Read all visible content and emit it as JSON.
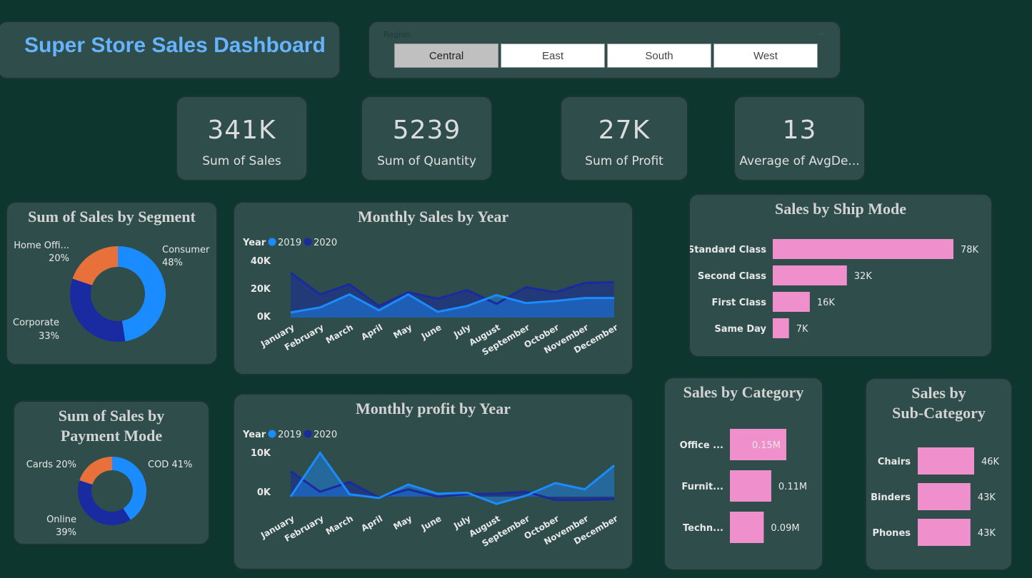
{
  "dashboard": {
    "title": "Super Store Sales Dashboard"
  },
  "slicer": {
    "title": "Region",
    "options": [
      "Central",
      "East",
      "South",
      "West"
    ],
    "selected": "Central"
  },
  "kpis": [
    {
      "value": "341K",
      "label": "Sum of Sales"
    },
    {
      "value": "5239",
      "label": "Sum of Quantity"
    },
    {
      "value": "27K",
      "label": "Sum of Profit"
    },
    {
      "value": "13",
      "label": "Average of AvgDe..."
    }
  ],
  "colors": {
    "background": "#0d362f",
    "card": "#2f4e4b",
    "title_blue": "#66b3ff",
    "series_2019": "#1a8cff",
    "series_2020": "#1a2aa0",
    "accent_orange": "#e8703a",
    "bar_pink": "#ef8fcb",
    "chevron": "chevron-down-icon"
  },
  "chart_data": [
    {
      "id": "segment",
      "type": "pie",
      "title": "Sum of Sales by Segment",
      "categories": [
        "Consumer",
        "Corporate",
        "Home Offi..."
      ],
      "values": [
        48,
        33,
        20
      ],
      "labels": [
        "48%",
        "33%",
        "20%"
      ],
      "colors": [
        "#1a8cff",
        "#1a2aa0",
        "#e8703a"
      ]
    },
    {
      "id": "payment",
      "type": "pie",
      "title_lines": [
        "Sum of Sales by",
        "Payment Mode"
      ],
      "categories": [
        "COD",
        "Online",
        "Cards"
      ],
      "values": [
        41,
        39,
        20
      ],
      "labels": [
        "COD 41%",
        "39%",
        "Cards 20%"
      ],
      "colors": [
        "#1a8cff",
        "#1a2aa0",
        "#e8703a"
      ]
    },
    {
      "id": "monthly_sales",
      "type": "area",
      "title": "Monthly Sales by Year",
      "legend_title": "Year",
      "categories": [
        "January",
        "February",
        "March",
        "April",
        "May",
        "June",
        "July",
        "August",
        "September",
        "October",
        "November",
        "December"
      ],
      "series": [
        {
          "name": "2019",
          "values": [
            3500,
            7000,
            16000,
            5000,
            16000,
            4000,
            8000,
            15500,
            10000,
            11500,
            13500,
            13500
          ]
        },
        {
          "name": "2020",
          "values": [
            31000,
            16000,
            23000,
            8000,
            17500,
            13000,
            19000,
            9500,
            21000,
            17500,
            24000,
            24500
          ]
        }
      ],
      "yticks": [
        "40K",
        "20K",
        "0K"
      ],
      "ylim": [
        0,
        40000
      ]
    },
    {
      "id": "monthly_profit",
      "type": "area",
      "title": "Monthly profit by Year",
      "legend_title": "Year",
      "categories": [
        "January",
        "February",
        "March",
        "April",
        "May",
        "June",
        "July",
        "August",
        "September",
        "October",
        "November",
        "December"
      ],
      "series": [
        {
          "name": "2019",
          "values": [
            0,
            9000,
            500,
            -300,
            2500,
            600,
            800,
            -1500,
            200,
            2800,
            1500,
            6400
          ]
        },
        {
          "name": "2020",
          "values": [
            5200,
            1000,
            3000,
            -200,
            1500,
            0,
            500,
            600,
            1000,
            -700,
            -700,
            -500
          ]
        }
      ],
      "yticks": [
        "10K",
        "0K"
      ],
      "ylim": [
        -2500,
        11000
      ]
    },
    {
      "id": "ship_mode",
      "type": "bar",
      "title": "Sales by Ship Mode",
      "categories": [
        "Standard Class",
        "Second Class",
        "First Class",
        "Same Day"
      ],
      "values": [
        78,
        32,
        16,
        7
      ],
      "labels": [
        "78K",
        "32K",
        "16K",
        "7K"
      ]
    },
    {
      "id": "category",
      "type": "bar",
      "title": "Sales by Category",
      "categories": [
        "Office ...",
        "Furnit...",
        "Techn..."
      ],
      "values": [
        0.15,
        0.11,
        0.09
      ],
      "labels": [
        "0.15M",
        "0.11M",
        "0.09M"
      ]
    },
    {
      "id": "subcategory",
      "type": "bar",
      "title_lines": [
        "Sales by",
        "Sub-Category"
      ],
      "categories": [
        "Chairs",
        "Binders",
        "Phones"
      ],
      "values": [
        46,
        43,
        43
      ],
      "labels": [
        "46K",
        "43K",
        "43K"
      ]
    }
  ]
}
